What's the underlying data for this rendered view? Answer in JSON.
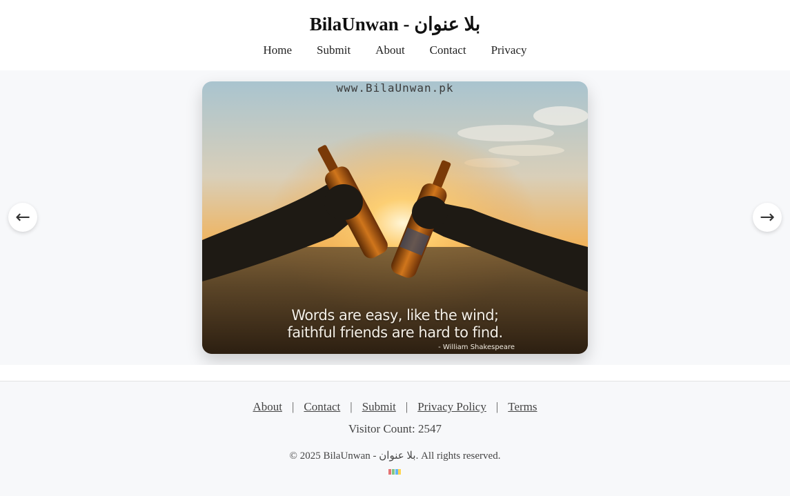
{
  "header": {
    "title": "BilaUnwan - بلا عنوان",
    "nav": [
      "Home",
      "Submit",
      "About",
      "Contact",
      "Privacy"
    ]
  },
  "carousel": {
    "watermark": "www.BilaUnwan.pk",
    "quote_line1": "Words are easy, like the wind;",
    "quote_line2": "faithful friends are hard to find.",
    "quote_author": "- William Shakespeare",
    "prev_icon": "←",
    "next_icon": "→"
  },
  "footer": {
    "links": [
      "About",
      "Contact",
      "Submit",
      "Privacy Policy",
      "Terms"
    ],
    "separator": "|",
    "visitor_label": "Visitor Count: 2547",
    "copyright": "© 2025 BilaUnwan - بلا عنوان. All rights reserved."
  },
  "colors": {
    "page_bg": "#f7f8fa",
    "header_bg": "#ffffff",
    "text": "#333333"
  }
}
